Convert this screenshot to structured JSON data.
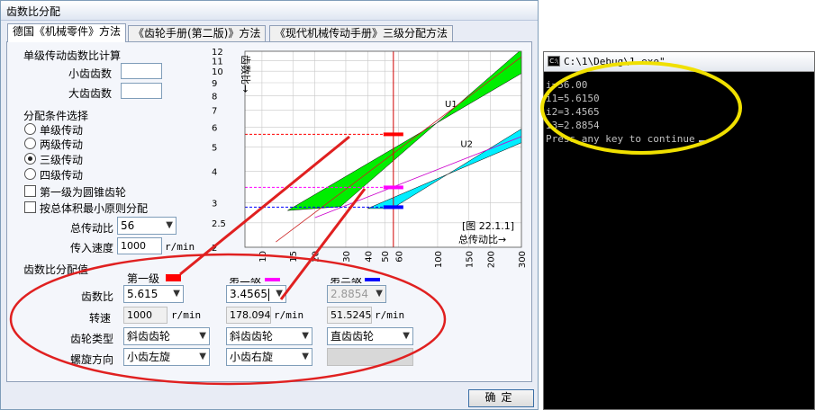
{
  "dialog": {
    "title": "齿数比分配",
    "tabs": [
      {
        "label": "德国《机械零件》方法"
      },
      {
        "label": "《齿轮手册(第二版)》方法"
      },
      {
        "label": "《现代机械传动手册》三级分配方法"
      }
    ],
    "single_stage": {
      "title": "单级传动齿数比计算",
      "small_gear_label": "小齿齿数",
      "large_gear_label": "大齿齿数"
    },
    "conditions": {
      "title": "分配条件选择",
      "options": [
        "单级传动",
        "两级传动",
        "三级传动",
        "四级传动"
      ],
      "selected_index": 2,
      "check_bevel": "第一级为圆锥齿轮",
      "check_volume": "按总体积最小原则分配"
    },
    "total_ratio": {
      "label": "总传动比",
      "value": "56"
    },
    "input_speed": {
      "label": "传入速度",
      "value": "1000",
      "unit": "r/min"
    },
    "alloc": {
      "title": "齿数比分配值",
      "row_ratio": "齿数比",
      "row_speed": "转速",
      "row_type": "齿轮类型",
      "row_helix": "螺旋方向",
      "speed_unit": "r/min",
      "stages": [
        {
          "name": "第一级",
          "color": "#ff0000",
          "ratio": "5.615",
          "speed": "1000",
          "type": "斜齿齿轮",
          "helix": "小齿左旋"
        },
        {
          "name": "第二级",
          "color": "#ff00ff",
          "ratio": "3.4565",
          "speed": "178.094",
          "type": "斜齿齿轮",
          "helix": "小齿右旋"
        },
        {
          "name": "第三级",
          "color": "#0000ff",
          "ratio": "2.8854",
          "speed": "51.5245",
          "type": "直齿齿轮",
          "helix": ""
        }
      ]
    },
    "ok_label": "确定"
  },
  "chart_data": {
    "type": "area",
    "ylabel": "齿数比→",
    "xlabel": "总传动比→",
    "caption": "[图 22.1.1]",
    "x_scale": "log",
    "y_scale": "log",
    "x_ticks": [
      10,
      15,
      20,
      30,
      40,
      50,
      60,
      100,
      150,
      200,
      300
    ],
    "y_ticks": [
      2,
      2.5,
      3,
      4,
      5,
      6,
      7,
      8,
      9,
      10,
      11,
      12
    ],
    "xlim": [
      8,
      300
    ],
    "ylim": [
      2,
      12
    ],
    "series": [
      {
        "name": "U1",
        "color": "#00ee00",
        "lower": [
          [
            14,
            2.8
          ],
          [
            300,
            9.8
          ]
        ],
        "upper": [
          [
            28,
            2.9
          ],
          [
            300,
            12.2
          ]
        ]
      },
      {
        "name": "U2",
        "color": "#00eeff",
        "lower": [
          [
            40,
            2.85
          ],
          [
            300,
            5.2
          ]
        ],
        "upper": [
          [
            55,
            2.85
          ],
          [
            300,
            5.9
          ]
        ]
      }
    ],
    "vertical_line": 56,
    "markers": [
      {
        "stage": "第一级",
        "x": 56,
        "y": 5.615,
        "color": "#ff0000"
      },
      {
        "stage": "第二级",
        "x": 56,
        "y": 3.4565,
        "color": "#ff00ff"
      },
      {
        "stage": "第三级",
        "x": 56,
        "y": 2.8854,
        "color": "#0000ff"
      }
    ],
    "grid": true
  },
  "console": {
    "title": "C:\\1\\Debug\\1.exe\"",
    "lines": [
      "i=56.00",
      "i1=5.6150",
      "i2=3.4565",
      "i3=2.8854",
      "Press any key to continue"
    ]
  },
  "colors": {
    "annotation_red": "#e02020",
    "annotation_yellow": "#f0e000",
    "chart_bg": "#ffffff"
  }
}
